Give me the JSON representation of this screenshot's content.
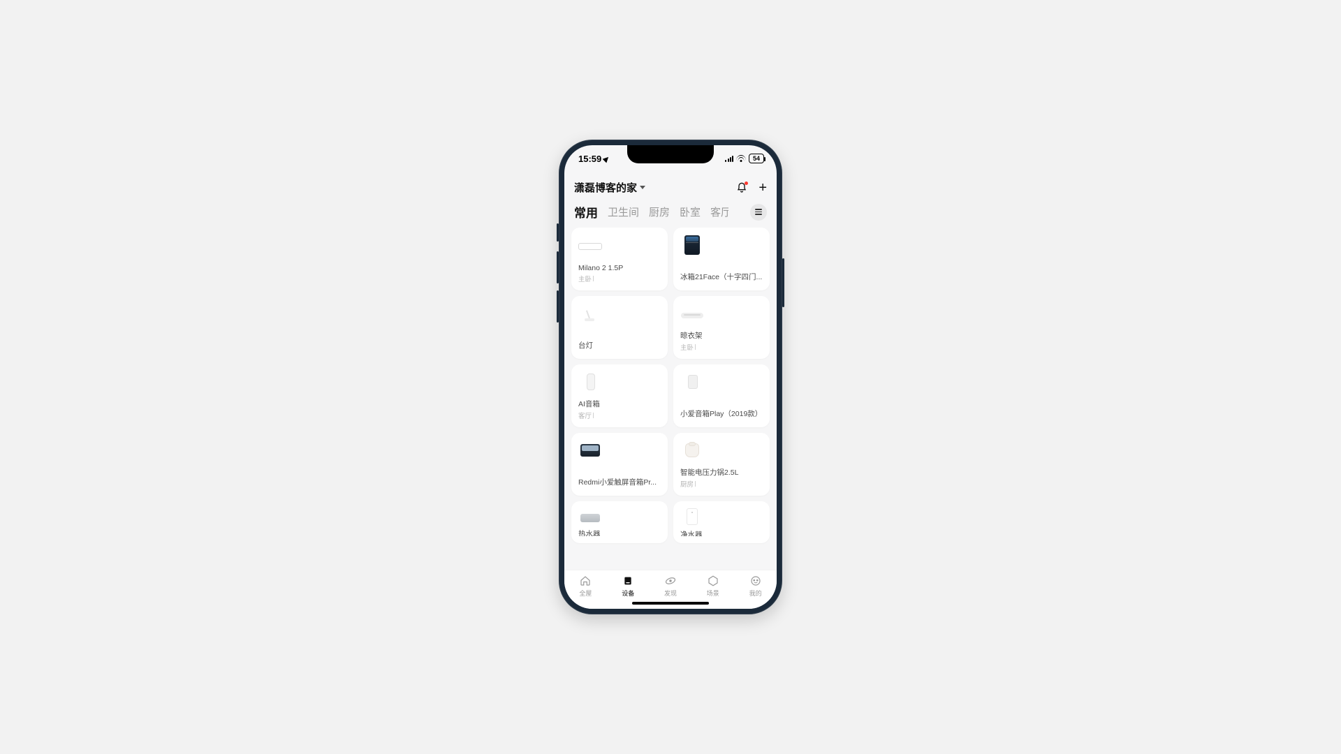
{
  "status": {
    "time": "15:59",
    "battery": "54"
  },
  "header": {
    "home_title": "潇磊博客的家"
  },
  "tabs": [
    "常用",
    "卫生间",
    "厨房",
    "卧室",
    "客厅"
  ],
  "devices": [
    {
      "name": "Milano 2 1.5P",
      "room": "主卧",
      "thumb": "ac"
    },
    {
      "name": "冰箱21Face（十字四门...",
      "room": "",
      "thumb": "fridge"
    },
    {
      "name": "台灯",
      "room": "",
      "thumb": "lamp"
    },
    {
      "name": "晾衣架",
      "room": "主卧",
      "thumb": "rack"
    },
    {
      "name": "AI音箱",
      "room": "客厅",
      "thumb": "sp1"
    },
    {
      "name": "小爱音箱Play（2019款）",
      "room": "",
      "thumb": "sp2"
    },
    {
      "name": "Redmi小爱触屏音箱Pr...",
      "room": "",
      "thumb": "screen"
    },
    {
      "name": "智能电压力锅2.5L",
      "room": "厨房",
      "thumb": "pot"
    },
    {
      "name": "热水器",
      "room": "",
      "thumb": "heater"
    },
    {
      "name": "净水器",
      "room": "",
      "thumb": "purifier"
    }
  ],
  "bottom_tabs": [
    {
      "label": "全屋"
    },
    {
      "label": "设备"
    },
    {
      "label": "发现"
    },
    {
      "label": "场景"
    },
    {
      "label": "我的"
    }
  ]
}
